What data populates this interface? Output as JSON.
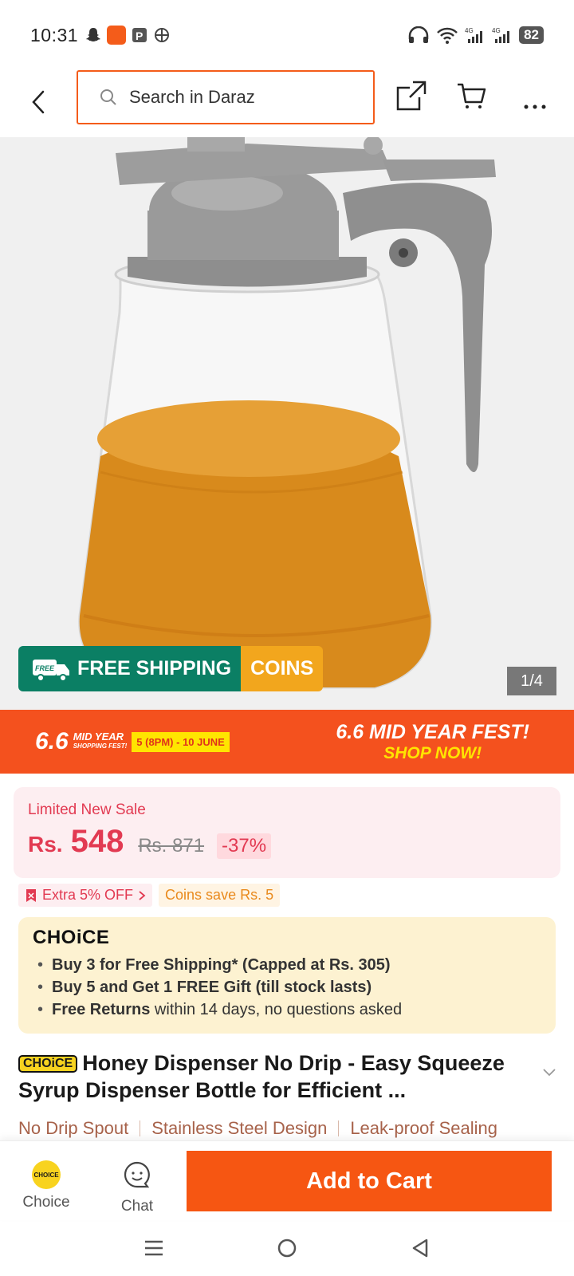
{
  "status": {
    "time": "10:31",
    "battery": "82"
  },
  "header": {
    "search_placeholder": "Search in Daraz"
  },
  "product_image": {
    "counter": "1/4",
    "badge_free": "FREE SHIPPING",
    "badge_free_small": "FREE",
    "badge_coins": "COINS"
  },
  "promo": {
    "logo_num": "6.6",
    "logo_mid": "MID YEAR",
    "logo_small": "SHOPPING FEST!",
    "date": "5 (8PM) - 10 JUNE",
    "line1": "6.6 MID YEAR FEST!",
    "line2": "SHOP NOW!"
  },
  "price": {
    "sale_label": "Limited New Sale",
    "currency": "Rs.",
    "current": "548",
    "original": "Rs. 871",
    "discount": "-37%"
  },
  "offers": {
    "extra": "Extra 5% OFF",
    "coins": "Coins save Rs. 5"
  },
  "choice": {
    "logo": "CHOiCE",
    "item1": "Buy 3 for  Free Shipping* (Capped at Rs. 305)",
    "item2": "Buy 5 and Get 1 FREE Gift (till stock lasts)",
    "item3_bold": "Free Returns",
    "item3_rest": " within 14 days, no questions asked"
  },
  "product": {
    "badge": "CHOiCE",
    "title": "Honey Dispenser No Drip - Easy Squeeze Syrup Dispenser Bottle for Efficient ...",
    "features": [
      "No Drip Spout",
      "Stainless Steel Design",
      "Leak-proof Sealing"
    ]
  },
  "bottom": {
    "choice_label": "Choice",
    "choice_icon_text": "CHOICE",
    "chat_label": "Chat",
    "add_to_cart": "Add to Cart"
  },
  "colors": {
    "accent": "#f65612",
    "price_red": "#e23a52",
    "ship_green": "#0b7f64",
    "choice_bg": "#fdf2d1"
  }
}
